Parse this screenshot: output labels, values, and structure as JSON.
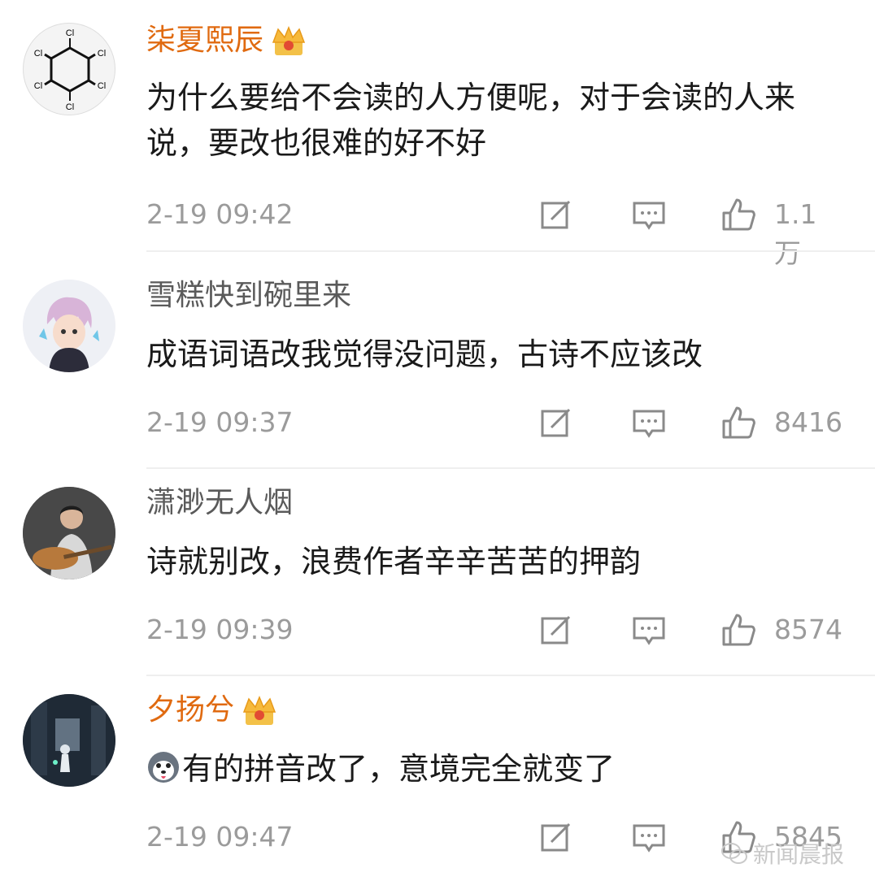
{
  "comments": [
    {
      "username": "柒夏熙辰",
      "vip": true,
      "avatar": "hexachlorocyclohexane-avatar",
      "text": "为什么要给不会读的人方便呢，对于会读的人来说，要改也很难的好不好",
      "time": "2-19 09:42",
      "likes": "1.1万"
    },
    {
      "username": "雪糕快到碗里来",
      "vip": false,
      "avatar": "anime-character-avatar",
      "text": "成语词语改我觉得没问题，古诗不应该改",
      "time": "2-19 09:37",
      "likes": "8416"
    },
    {
      "username": "潇渺无人烟",
      "vip": false,
      "avatar": "guitar-singer-avatar",
      "text": "诗就别改，浪费作者辛辛苦苦的押韵",
      "time": "2-19 09:39",
      "likes": "8574"
    },
    {
      "username": "夕扬兮",
      "vip": true,
      "avatar": "dark-scene-avatar",
      "text": "有的拼音改了，意境完全就变了",
      "emoji": "husky-emoji",
      "time": "2-19 09:47",
      "likes": "5845"
    }
  ],
  "watermark": "新闻晨报",
  "colors": {
    "vip_name": "#e06a10",
    "normal_name": "#5a5a5a",
    "meta": "#9b9b9b"
  }
}
